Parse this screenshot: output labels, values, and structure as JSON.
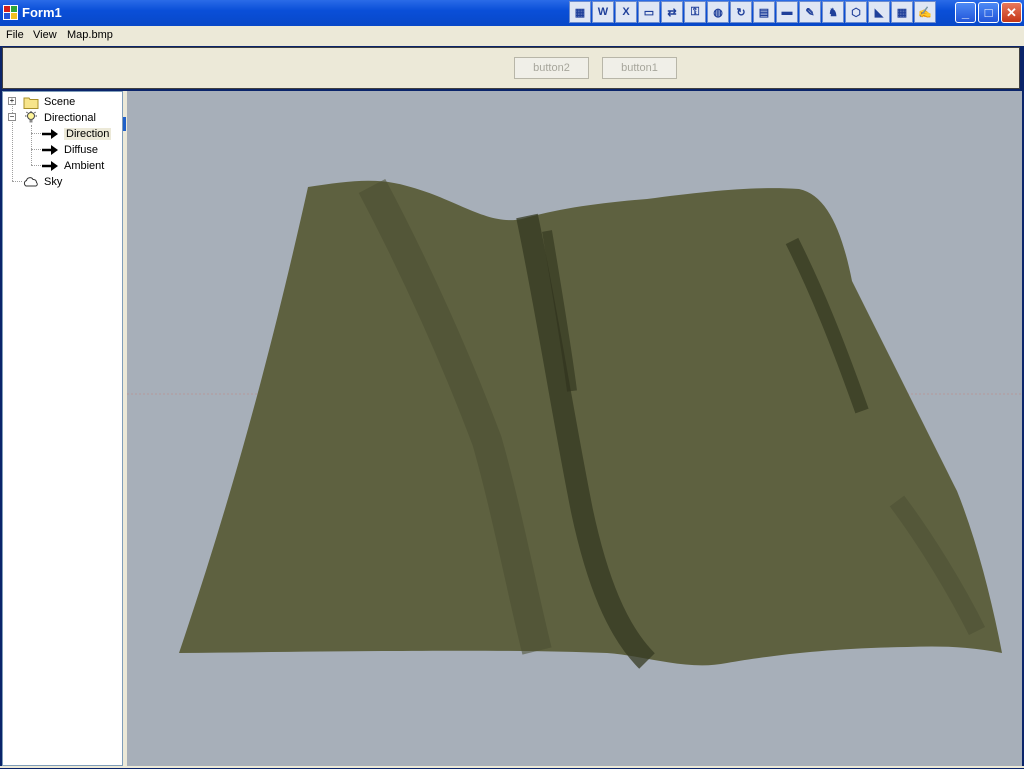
{
  "window": {
    "title": "Form1"
  },
  "window_controls": {
    "minimize": "_",
    "maximize": "□",
    "close": "✕"
  },
  "tray_icons": [
    "app-grid",
    "W",
    "X",
    "screen",
    "network",
    "key",
    "globe",
    "refresh",
    "terminal",
    "cmd",
    "paint",
    "game",
    "cube",
    "pdf",
    "calendar",
    "notes"
  ],
  "menu": [
    {
      "label": "File"
    },
    {
      "label": "View"
    },
    {
      "label": "Map.bmp"
    }
  ],
  "toolbar": {
    "button2_label": "button2",
    "button1_label": "button1"
  },
  "tree": {
    "items": [
      {
        "label": "Scene",
        "icon": "folder-icon",
        "level": 0,
        "expander": "+"
      },
      {
        "label": "Directional",
        "icon": "lightbulb-icon",
        "level": 0,
        "expander": "−"
      },
      {
        "label": "Direction",
        "icon": "arrow-right-icon",
        "level": 1,
        "selected": true
      },
      {
        "label": "Diffuse",
        "icon": "arrow-right-icon",
        "level": 1
      },
      {
        "label": "Ambient",
        "icon": "arrow-right-icon",
        "level": 1
      },
      {
        "label": "Sky",
        "icon": "cloud-icon",
        "level": 0
      }
    ]
  },
  "viewport": {
    "background": "#a7afb9",
    "terrain_color": "#5e6140"
  }
}
